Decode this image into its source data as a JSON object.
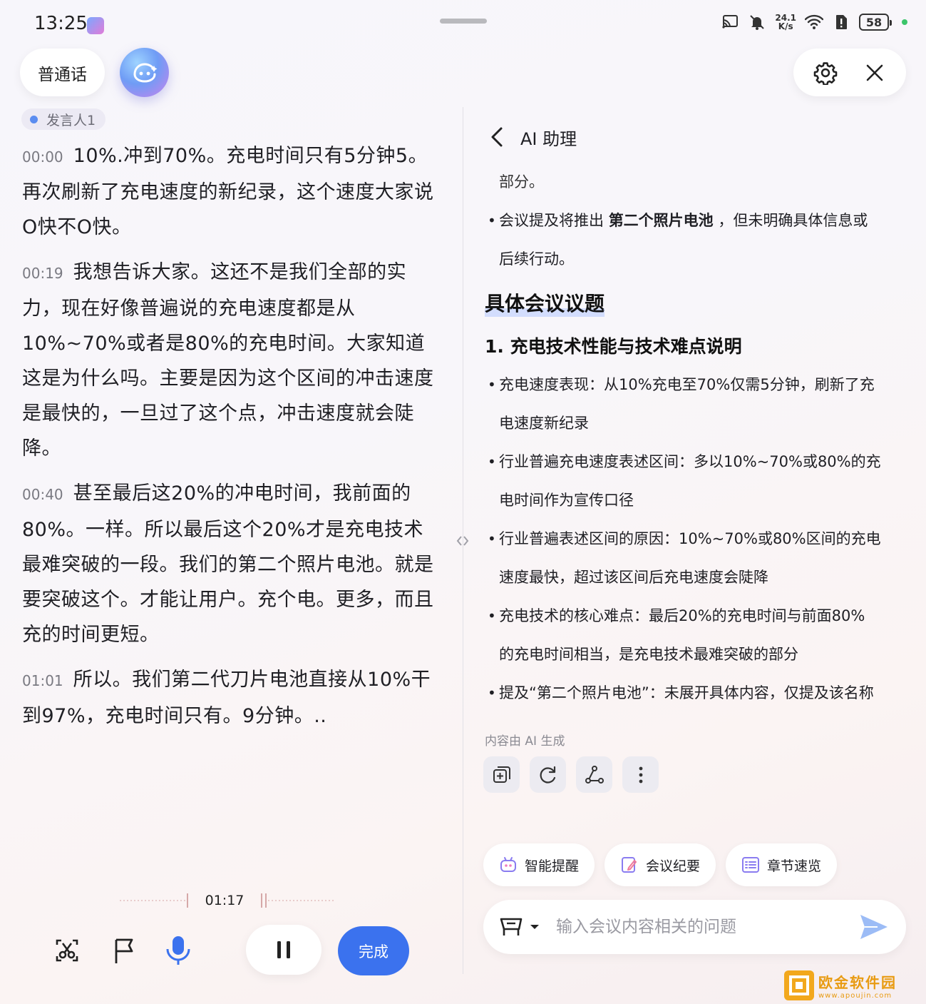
{
  "status": {
    "time": "13:25",
    "net_speed_top": "24.1",
    "net_speed_bottom": "K/s",
    "battery": "58"
  },
  "top": {
    "language_label": "普通话"
  },
  "left": {
    "speaker": "发言人1",
    "paragraphs": [
      {
        "time": "00:00",
        "text": "10%.冲到70%。充电时间只有5分钟5。再次刷新了充电速度的新纪录，这个速度大家说O快不O快。"
      },
      {
        "time": "00:19",
        "text": "我想告诉大家。这还不是我们全部的实力，现在好像普遍说的充电速度都是从10%~70%或者是80%的充电时间。大家知道这是为什么吗。主要是因为这个区间的冲击速度是最快的，一旦过了这个点，冲击速度就会陡降。"
      },
      {
        "time": "00:40",
        "text": "甚至最后这20%的冲电时间，我前面的80%。一样。所以最后这个20%才是充电技术最难突破的一段。我们的第二个照片电池。就是要突破这个。才能让用户。充个电。更多，而且充的时间更短。"
      },
      {
        "time": "01:01",
        "text": "所以。我们第二代刀片电池直接从10%干到97%，充电时间只有。9分钟。.."
      }
    ],
    "record_time": "01:17",
    "done_label": "完成"
  },
  "right": {
    "title": "AI 助理",
    "top_fragment": "部分。",
    "intro_bullet": {
      "before": "会议提及将推出 ",
      "bold": "第二个照片电池",
      "after": " ，但未明确具体信息或",
      "cont": "后续行动。"
    },
    "section_title": "具体会议议题",
    "sub_title": "1. 充电技术性能与技术难点说明",
    "bullets": [
      {
        "line1": "充电速度表现：从10%充电至70%仅需5分钟，刷新了充",
        "line2": "电速度新纪录"
      },
      {
        "line1": "行业普遍充电速度表述区间：多以10%~70%或80%的充",
        "line2": "电时间作为宣传口径"
      },
      {
        "line1": "行业普遍表述区间的原因：10%~70%或80%区间的充电",
        "line2": "速度最快，超过该区间后充电速度会陡降"
      },
      {
        "line1": "充电技术的核心难点：最后20%的充电时间与前面80%",
        "line2": "的充电时间相当，是充电技术最难突破的部分"
      },
      {
        "line1": "提及“第二个照片电池”：未展开具体内容，仅提及该名称",
        "line2": ""
      }
    ],
    "ai_note": "内容由 AI 生成",
    "chips": [
      {
        "label": "智能提醒",
        "icon": "robot-reminder-icon"
      },
      {
        "label": "会议纪要",
        "icon": "notes-edit-icon"
      },
      {
        "label": "章节速览",
        "icon": "chapter-list-icon"
      }
    ],
    "input_placeholder": "输入会议内容相关的问题"
  },
  "watermark": {
    "name": "欧金软件园",
    "url": "www.apoujin.com"
  },
  "colors": {
    "accent": "#3b72ee",
    "speaker_dot": "#5b8df0",
    "watermark": "#f2a81d"
  }
}
